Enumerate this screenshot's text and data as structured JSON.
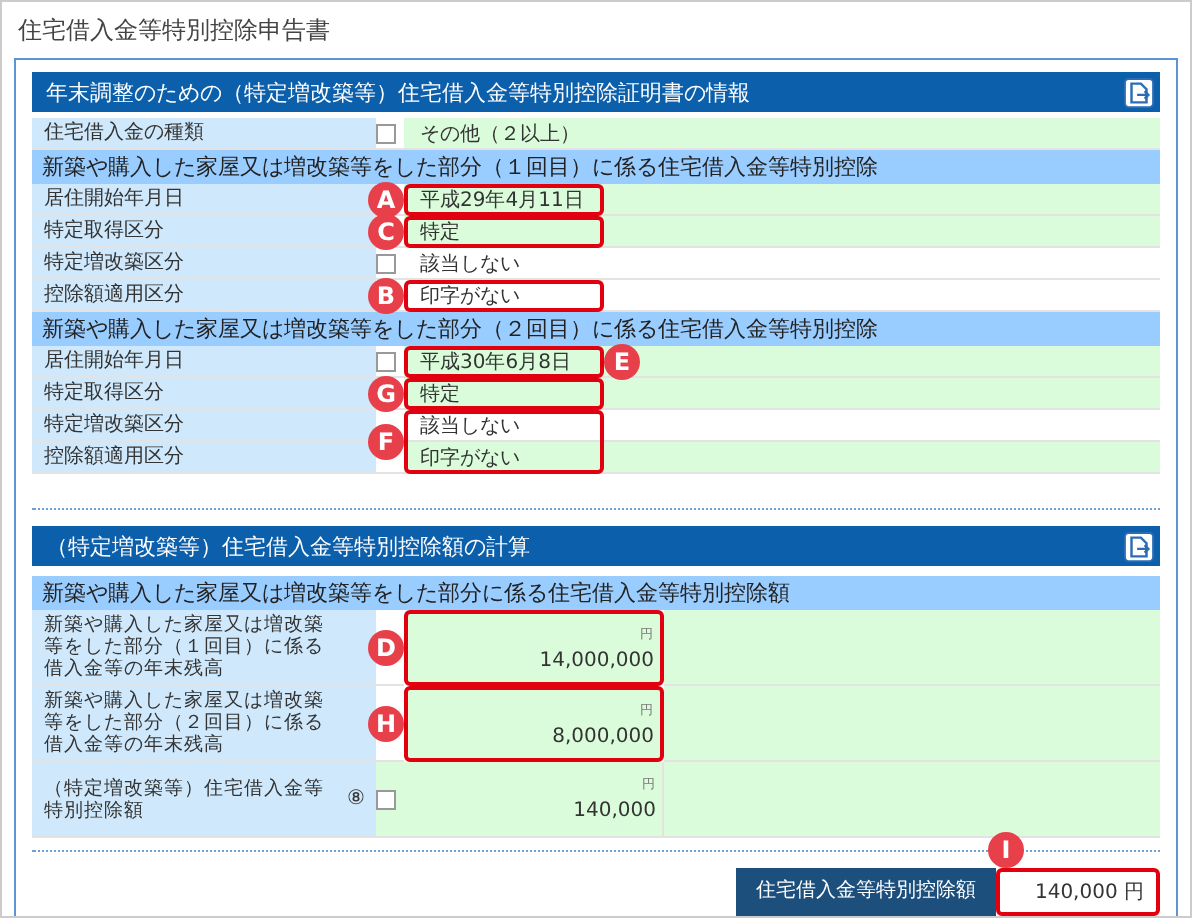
{
  "page_title": "住宅借入金等特別控除申告書",
  "info_section": {
    "title": "年末調整のための（特定増改築等）住宅借入金等特別控除証明書の情報",
    "groups": [
      {
        "rows": [
          {
            "label": "住宅借入金の種類",
            "checkbox": {
              "checked": false
            },
            "value": "その他（２以上）",
            "shaded": true
          }
        ]
      },
      {
        "heading": "新築や購入した家屋又は増改築等をした部分（１回目）に係る住宅借入金等特別控除",
        "rows": [
          {
            "label": "居住開始年月日",
            "value": "平成29年4月11日",
            "shaded": true,
            "annotation": {
              "letter": "A",
              "badge_after": false
            }
          },
          {
            "label": "特定取得区分",
            "value": "特定",
            "shaded": true,
            "annotation": {
              "letter": "C",
              "badge_after": false
            }
          },
          {
            "label": "特定増改築区分",
            "checkbox": {
              "checked": false
            },
            "value": "該当しない",
            "shaded": false
          },
          {
            "label": "控除額適用区分",
            "value": "印字がない",
            "shaded": false,
            "annotation": {
              "letter": "B",
              "badge_after": false
            }
          }
        ]
      },
      {
        "heading": "新築や購入した家屋又は増改築等をした部分（２回目）に係る住宅借入金等特別控除",
        "rows": [
          {
            "label": "居住開始年月日",
            "checkbox": {
              "checked": false
            },
            "value": "平成30年6月8日",
            "shaded": true,
            "annotation": {
              "letter": "E",
              "badge_after": true
            }
          },
          {
            "label": "特定取得区分",
            "value": "特定",
            "shaded": true,
            "annotation": {
              "letter": "G",
              "badge_after": false
            }
          },
          {
            "label": "特定増改築区分",
            "value": "該当しない",
            "shaded": false,
            "annotation": {
              "letter": "F",
              "badge_after": false,
              "spans_next_row": true
            }
          },
          {
            "label": "控除額適用区分",
            "value": "印字がない",
            "shaded": true
          }
        ]
      }
    ]
  },
  "calc_section": {
    "title": "（特定増改築等）住宅借入金等特別控除額の計算",
    "heading": "新築や購入した家屋又は増改築等をした部分に係る住宅借入金等特別控除額",
    "rows": [
      {
        "label": "新築や購入した家屋又は増改築等をした部分（１回目）に係る借入金等の年末残高",
        "unit": "円",
        "value": "14,000,000",
        "annotation": {
          "letter": "D"
        }
      },
      {
        "label": "新築や購入した家屋又は増改築等をした部分（２回目）に係る借入金等の年末残高",
        "unit": "円",
        "value": "8,000,000",
        "annotation": {
          "letter": "H"
        }
      },
      {
        "label": "（特定増改築等）住宅借入金等特別控除額",
        "number": "⑧",
        "checkbox": {
          "checked": false
        },
        "unit": "円",
        "value": "140,000"
      }
    ]
  },
  "total": {
    "label": "住宅借入金等特別控除額",
    "value": "140,000",
    "unit": "円",
    "annotation": {
      "letter": "I"
    }
  }
}
